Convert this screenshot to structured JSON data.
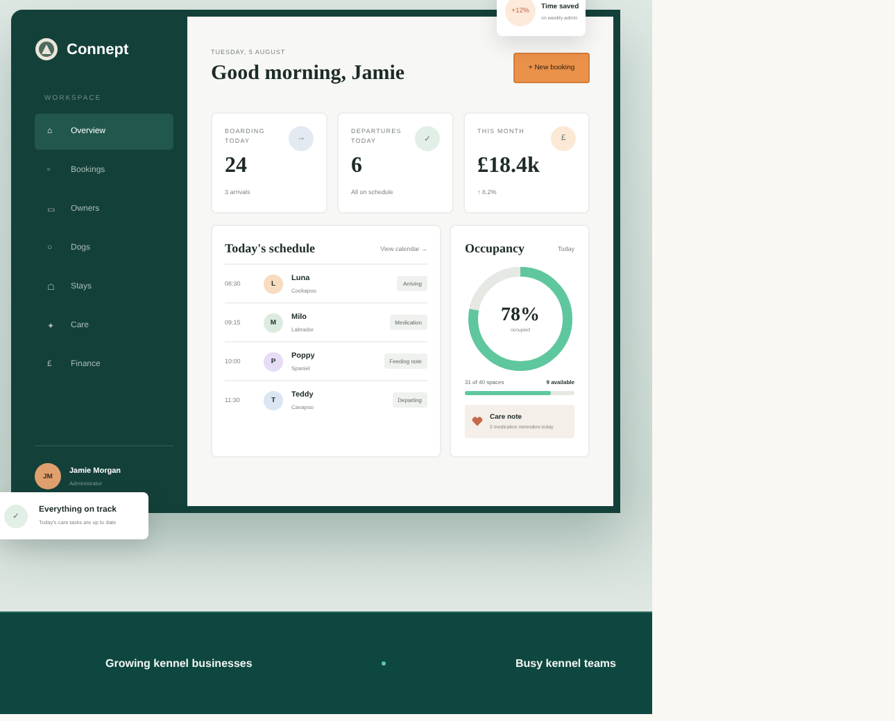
{
  "brand": {
    "name": "Connept"
  },
  "sidebar": {
    "section_label": "WORKSPACE",
    "items": [
      {
        "icon": "⌂",
        "label": "Overview",
        "selected": true
      },
      {
        "icon": "▫",
        "label": "Bookings",
        "selected": false
      },
      {
        "icon": "▭",
        "label": "Owners",
        "selected": false
      },
      {
        "icon": "○",
        "label": "Dogs",
        "selected": false
      },
      {
        "icon": "☖",
        "label": "Stays",
        "selected": false
      },
      {
        "icon": "✦",
        "label": "Care",
        "selected": false
      },
      {
        "icon": "£",
        "label": "Finance",
        "selected": false
      }
    ],
    "user": {
      "initials": "JM",
      "name": "Jamie Morgan",
      "role": "Administrator"
    }
  },
  "header": {
    "date": "TUESDAY, 5 AUGUST",
    "greeting": "Good morning, Jamie",
    "button": "+ New booking"
  },
  "stats": [
    {
      "label": "BOARDING TODAY",
      "value": "24",
      "note": "3 arrivals",
      "icon": "→",
      "color": "#e3eaf2"
    },
    {
      "label": "DEPARTURES TODAY",
      "value": "6",
      "note": "All on schedule",
      "icon": "✓",
      "color": "#e2efe7"
    },
    {
      "label": "THIS MONTH",
      "value": "£18.4k",
      "note": "↑ 8.2%",
      "icon": "£",
      "color": "#fbe9d6"
    }
  ],
  "schedule": {
    "title": "Today's schedule",
    "link": "View calendar →",
    "rows": [
      {
        "time": "08:30",
        "initial": "L",
        "color": "#f7dcc0",
        "name": "Luna",
        "breed": "Cockapoo",
        "tag": "Arriving"
      },
      {
        "time": "09:15",
        "initial": "M",
        "color": "#dcebe0",
        "name": "Milo",
        "breed": "Labrador",
        "tag": "Medication"
      },
      {
        "time": "10:00",
        "initial": "P",
        "color": "#e6dcf5",
        "name": "Poppy",
        "breed": "Spaniel",
        "tag": "Feeding note"
      },
      {
        "time": "11:30",
        "initial": "T",
        "color": "#dce5f2",
        "name": "Teddy",
        "breed": "Cavapoo",
        "tag": "Departing"
      }
    ]
  },
  "occupancy": {
    "title": "Occupancy",
    "period": "Today",
    "percent": "78%",
    "caption": "occupied",
    "level": 0.78,
    "spaces": "31 of 40 spaces",
    "available": "9 available",
    "note_title": "Care note",
    "note_text": "2 medication reminders today"
  },
  "toasts": [
    {
      "title": "Everything on track",
      "text": "Today's care tasks are up to date",
      "icon": "✓"
    }
  ],
  "time_saved": {
    "badge": "+12%",
    "title": "Time saved",
    "text": "on weekly admin"
  },
  "footer": {
    "items": [
      "Growing kennel businesses",
      "Busy kennel teams"
    ]
  }
}
